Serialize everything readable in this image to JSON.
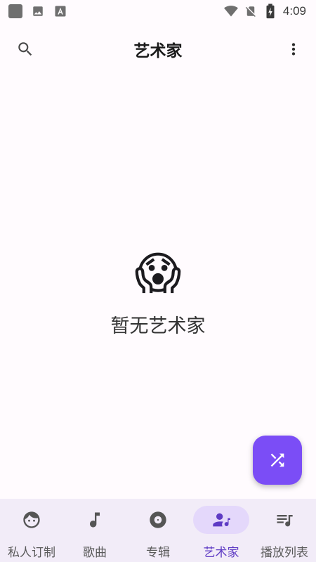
{
  "status_bar": {
    "time": "4:09",
    "icons": [
      "app-square-icon",
      "image-icon",
      "font-icon",
      "wifi-icon",
      "no-sim-icon",
      "battery-charging-icon"
    ]
  },
  "app_bar": {
    "title": "艺术家",
    "left_icon": "search-icon",
    "right_icon": "more-vert-icon"
  },
  "empty_state": {
    "emoji": "😱",
    "message": "暂无艺术家"
  },
  "fab": {
    "icon": "shuffle-icon",
    "color": "#7b4df6"
  },
  "bottom_nav": {
    "items": [
      {
        "label": "私人订制",
        "icon": "face-icon"
      },
      {
        "label": "歌曲",
        "icon": "music-note-icon"
      },
      {
        "label": "专辑",
        "icon": "album-icon"
      },
      {
        "label": "艺术家",
        "icon": "artist-icon",
        "active": true
      },
      {
        "label": "播放列表",
        "icon": "playlist-icon"
      }
    ],
    "active_color": "#5e3bc4",
    "active_pill_color": "#e4d8fb"
  }
}
